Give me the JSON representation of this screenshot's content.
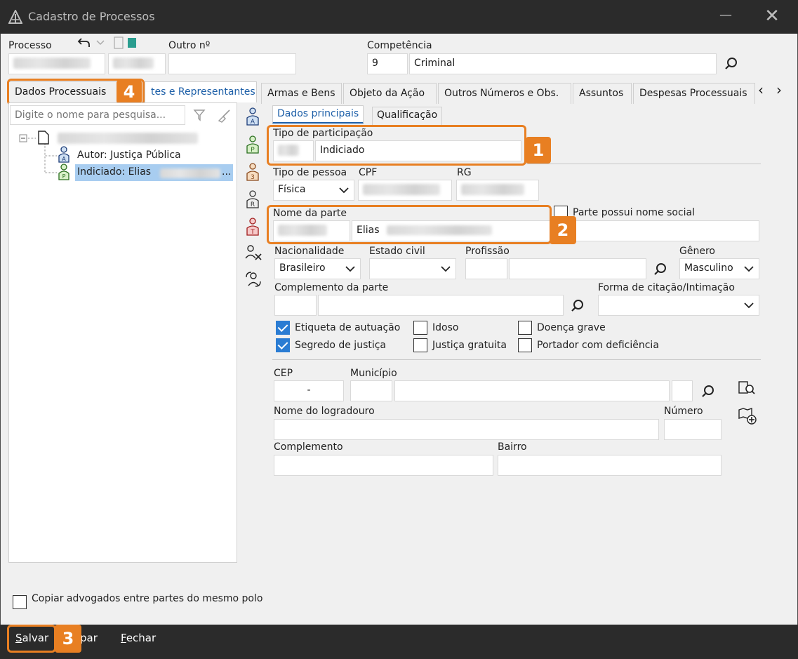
{
  "window": {
    "title": "Cadastro de Processos",
    "min_glyph": "—",
    "close_glyph": "✕"
  },
  "header": {
    "processo_label": "Processo",
    "outro_label": "Outro nº",
    "competencia_label": "Competência",
    "competencia_code": "9",
    "competencia_value": "Criminal"
  },
  "tabs": [
    {
      "label": "Dados Processuais"
    },
    {
      "label": "tes e Representantes"
    },
    {
      "label": "Armas e Bens"
    },
    {
      "label": "Objeto da Ação"
    },
    {
      "label": "Outros Números e Obs."
    },
    {
      "label": "Assuntos"
    },
    {
      "label": "Despesas Processuais"
    }
  ],
  "tab_nav": {
    "prev": "‹",
    "next": "›"
  },
  "left": {
    "search_placeholder": "Digite o nome para pesquisa...",
    "tree": [
      {
        "label": "Autor: Justiça Pública",
        "badge": "A"
      },
      {
        "label": "Indiciado: Elias",
        "badge": "P"
      }
    ],
    "tree_ellipsis": "...",
    "copy_label": "Copiar advogados entre partes do mesmo polo"
  },
  "icon_letters": [
    "A",
    "P",
    "3",
    "R",
    "T"
  ],
  "subtabs": {
    "main": "Dados principais",
    "qual": "Qualificação"
  },
  "form": {
    "tipo_participacao_label": "Tipo de participação",
    "tipo_participacao_value": "Indiciado",
    "tipo_pessoa_label": "Tipo de pessoa",
    "tipo_pessoa_value": "Física",
    "cpf_label": "CPF",
    "rg_label": "RG",
    "nome_parte_label": "Nome da parte",
    "nome_parte_value": "Elias",
    "nome_social_label": "Parte possui nome social",
    "nacionalidade_label": "Nacionalidade",
    "nacionalidade_value": "Brasileiro",
    "estado_civil_label": "Estado civil",
    "profissao_label": "Profissão",
    "genero_label": "Gênero",
    "genero_value": "Masculino",
    "complemento_parte_label": "Complemento da parte",
    "forma_citacao_label": "Forma de citação/Intimação",
    "checkboxes": [
      {
        "label": "Etiqueta de autuação",
        "checked": true
      },
      {
        "label": "Idoso",
        "checked": false
      },
      {
        "label": "Doença grave",
        "checked": false
      },
      {
        "label": "Segredo de justiça",
        "checked": true
      },
      {
        "label": "Justiça gratuita",
        "checked": false
      },
      {
        "label": "Portador com deficiência",
        "checked": false
      }
    ],
    "cep_label": "CEP",
    "cep_value": "-",
    "municipio_label": "Município",
    "logradouro_label": "Nome do logradouro",
    "numero_label": "Número",
    "complemento_label": "Complemento",
    "bairro_label": "Bairro"
  },
  "bottom": {
    "salvar": "Salvar",
    "limpar": "par",
    "fechar": "Fechar"
  },
  "badges": {
    "b1": "1",
    "b2": "2",
    "b3": "3",
    "b4": "4"
  },
  "colors": {
    "accent": "#e87f22",
    "titlebar": "#2b2b2b",
    "selection": "#a8cdf0",
    "check": "#2a7cd3"
  }
}
